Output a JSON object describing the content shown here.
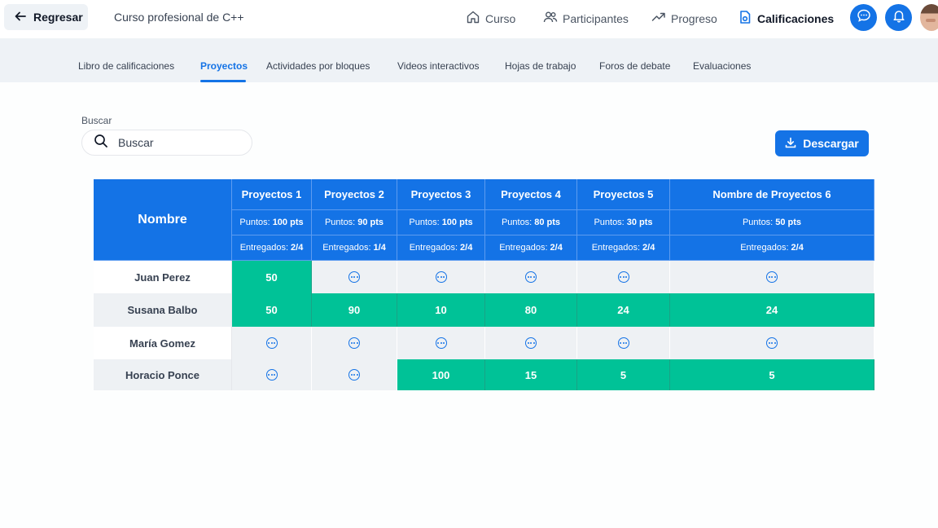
{
  "header": {
    "back_label": "Regresar",
    "course_title": "Curso profesional de C++",
    "nav": [
      {
        "label": "Curso",
        "icon": "home-icon"
      },
      {
        "label": "Participantes",
        "icon": "users-icon"
      },
      {
        "label": "Progreso",
        "icon": "trend-icon"
      },
      {
        "label": "Calificaciones",
        "icon": "grades-icon"
      }
    ]
  },
  "tabs": [
    {
      "label": "Libro de calificaciones"
    },
    {
      "label": "Proyectos"
    },
    {
      "label": "Actividades por bloques"
    },
    {
      "label": "Videos interactivos"
    },
    {
      "label": "Hojas de trabajo"
    },
    {
      "label": "Foros de debate"
    },
    {
      "label": "Evaluaciones"
    }
  ],
  "search": {
    "label": "Buscar",
    "placeholder": "Buscar"
  },
  "download_label": "Descargar",
  "table": {
    "name_header": "Nombre",
    "points_label": "Puntos:",
    "delivered_label": "Entregados:",
    "columns": [
      {
        "title": "Proyectos 1",
        "points": "100 pts",
        "delivered": "2/4"
      },
      {
        "title": "Proyectos 2",
        "points": "90 pts",
        "delivered": "1/4"
      },
      {
        "title": "Proyectos 3",
        "points": "100 pts",
        "delivered": "2/4"
      },
      {
        "title": "Proyectos 4",
        "points": "80 pts",
        "delivered": "2/4"
      },
      {
        "title": "Proyectos 5",
        "points": "30 pts",
        "delivered": "2/4"
      },
      {
        "title": "Nombre de Proyectos 6",
        "points": "50 pts",
        "delivered": "2/4"
      }
    ],
    "rows": [
      {
        "name": "Juan Perez",
        "scores": [
          "50",
          null,
          null,
          null,
          null,
          null
        ]
      },
      {
        "name": "Susana Balbo",
        "scores": [
          "50",
          "90",
          "10",
          "80",
          "24",
          "24"
        ]
      },
      {
        "name": "María Gomez",
        "scores": [
          null,
          null,
          null,
          null,
          null,
          null
        ]
      },
      {
        "name": "Horacio Ponce",
        "scores": [
          null,
          null,
          "100",
          "15",
          "5",
          "5"
        ]
      }
    ]
  },
  "colors": {
    "accent": "#1473e6",
    "score": "#00c297",
    "row_alt": "#eef1f4"
  }
}
